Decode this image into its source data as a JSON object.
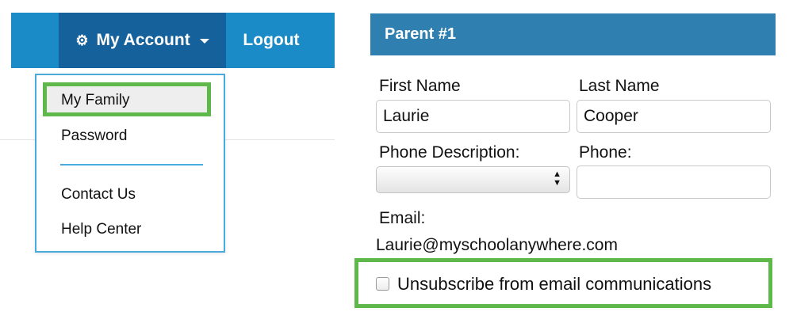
{
  "nav": {
    "account_label": "My Account",
    "logout_label": "Logout",
    "colors": {
      "bar": "#1b8bc8",
      "active": "#14619b"
    }
  },
  "dropdown": {
    "items": [
      {
        "label": "My Family",
        "highlighted": true
      },
      {
        "label": "Password"
      },
      {
        "label": "Contact Us"
      },
      {
        "label": "Help Center"
      }
    ],
    "highlight_color": "#5fb84a"
  },
  "parent": {
    "header": "Parent #1",
    "first_name_label": "First Name",
    "first_name_value": "Laurie",
    "last_name_label": "Last Name",
    "last_name_value": "Cooper",
    "phone_description_label": "Phone Description:",
    "phone_description_value": "",
    "phone_label": "Phone:",
    "phone_value": "",
    "email_label": "Email:",
    "email_value": "Laurie@myschoolanywhere.com",
    "unsubscribe_label": "Unsubscribe from email communications",
    "unsubscribe_checked": false
  }
}
